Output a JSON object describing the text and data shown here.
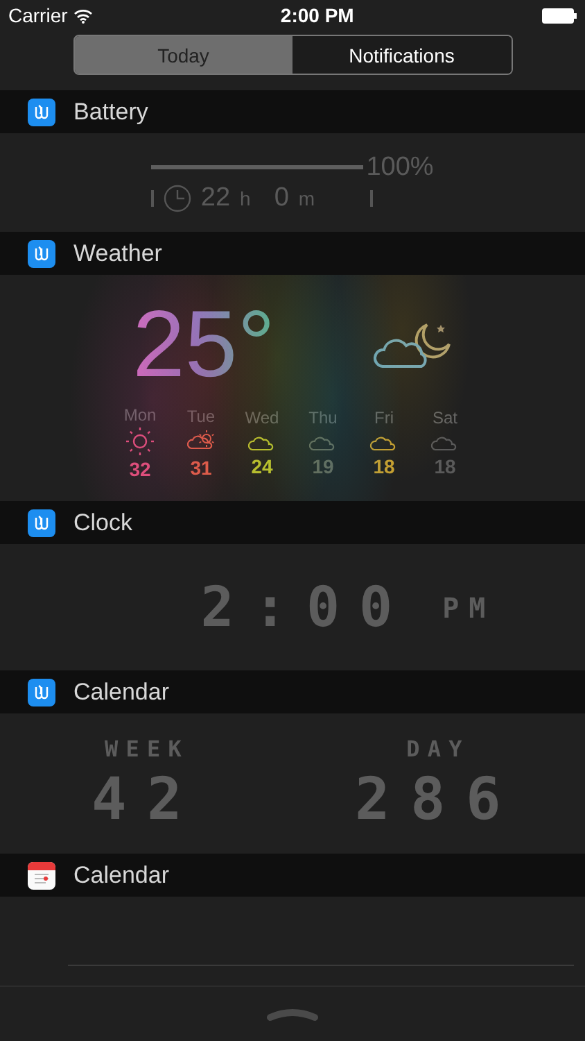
{
  "status_bar": {
    "carrier": "Carrier",
    "time": "2:00 PM"
  },
  "tabs": [
    {
      "label": "Today",
      "selected": true
    },
    {
      "label": "Notifications",
      "selected": false
    }
  ],
  "widgets": [
    {
      "kind": "battery",
      "title": "Battery",
      "level": 1.0,
      "percent": "100%",
      "hours": "22",
      "hours_unit": "h",
      "minutes": "0",
      "minutes_unit": "m"
    },
    {
      "kind": "weather",
      "title": "Weather",
      "temperature": "25°",
      "days": [
        {
          "day": "Mon",
          "kind": "sunny",
          "temp": "32",
          "color": "#e0507a"
        },
        {
          "day": "Tue",
          "kind": "partly",
          "temp": "31",
          "color": "#e0604a"
        },
        {
          "day": "Wed",
          "kind": "cloudy",
          "temp": "24",
          "color": "#b8c030"
        },
        {
          "day": "Thu",
          "kind": "cloudy",
          "temp": "19",
          "color": "#6a6a5a"
        },
        {
          "day": "Fri",
          "kind": "cloudy",
          "temp": "18",
          "color": "#c8a030"
        },
        {
          "day": "Sat",
          "kind": "cloudy",
          "temp": "18",
          "color": "#5a5a5a"
        }
      ]
    },
    {
      "kind": "clock",
      "title": "Clock",
      "time": "2:00",
      "period": "PM"
    },
    {
      "kind": "counter",
      "title": "Calendar",
      "items": [
        {
          "label": "WEEK",
          "value": "42"
        },
        {
          "label": "DAY",
          "value": "286"
        }
      ]
    },
    {
      "kind": "empty",
      "title": "Calendar"
    }
  ]
}
